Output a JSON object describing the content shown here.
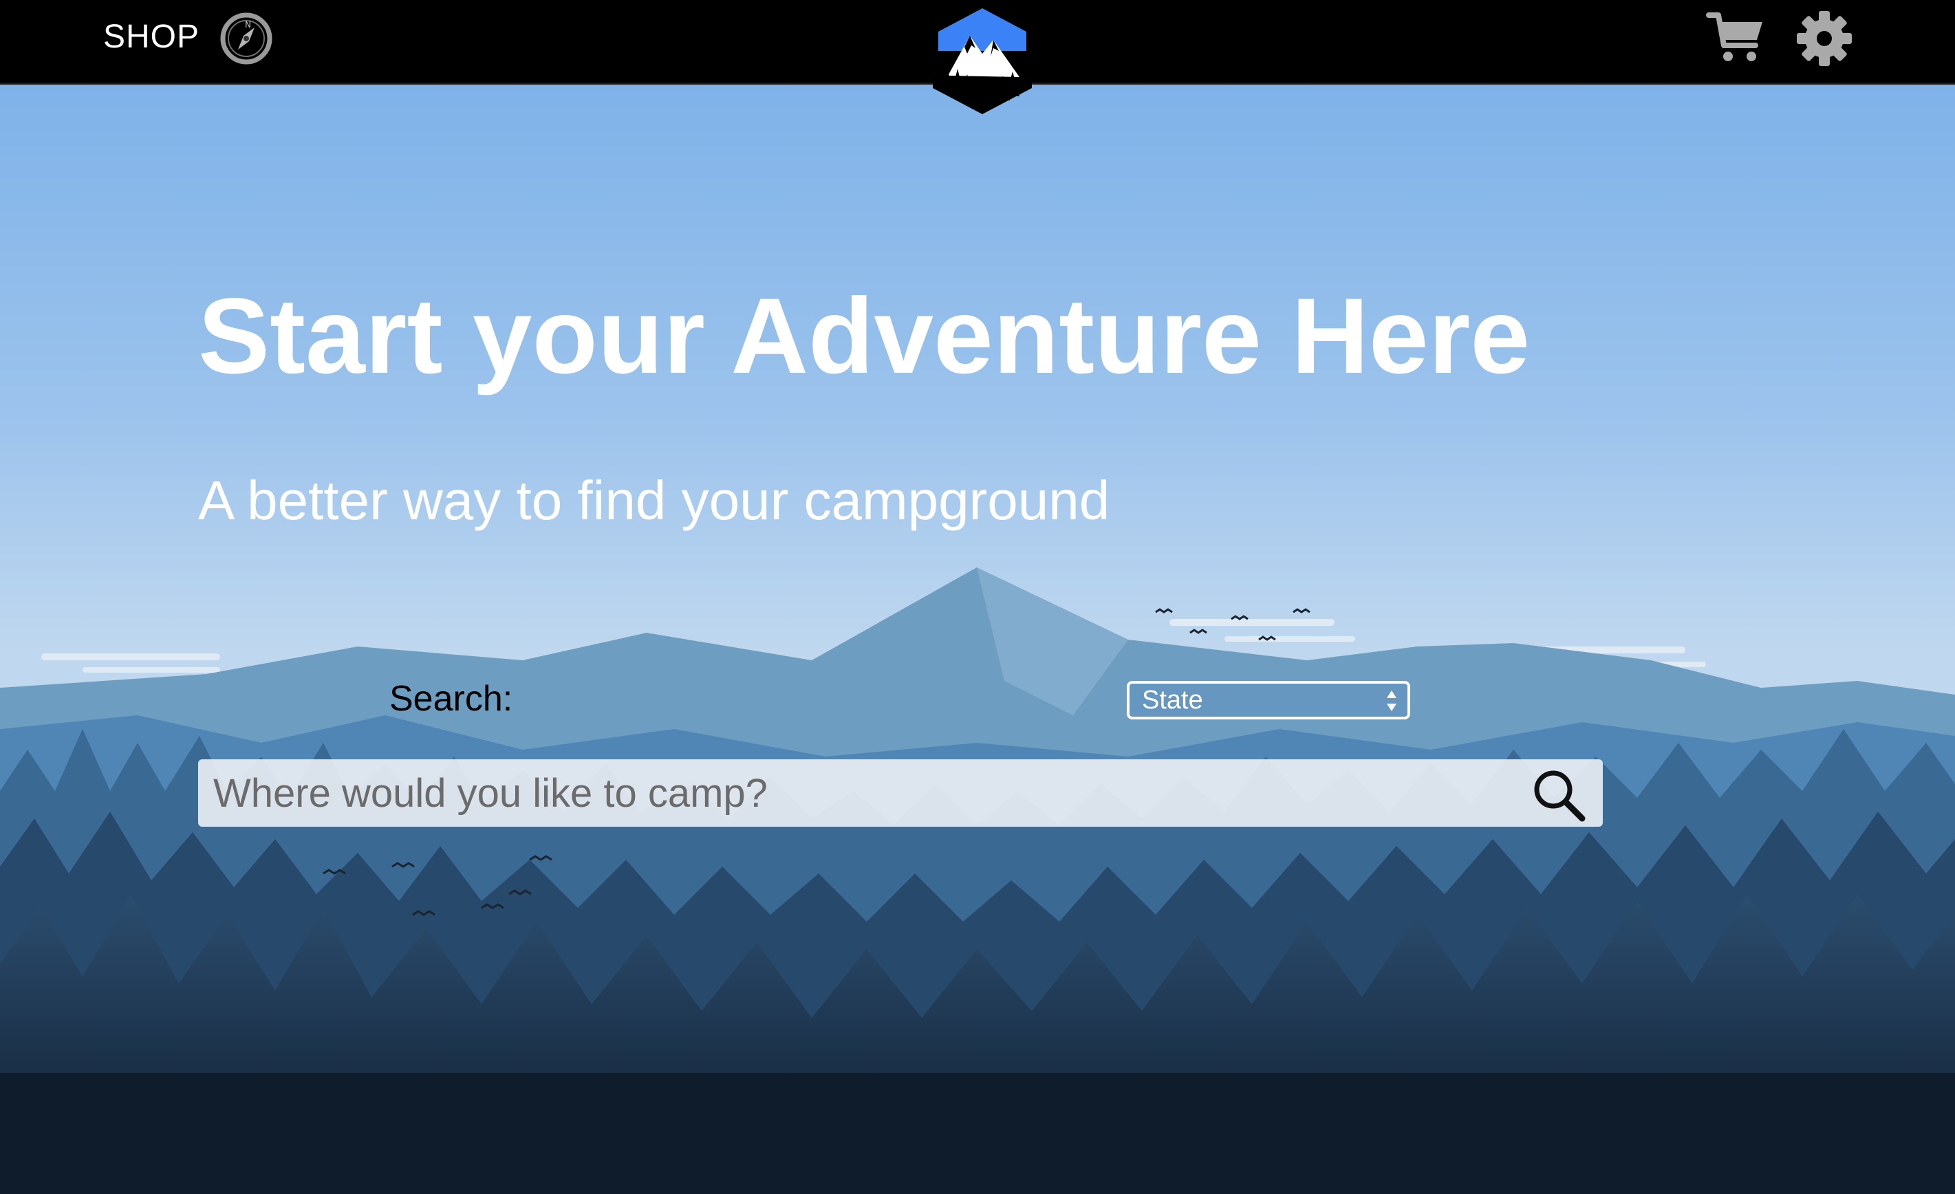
{
  "nav": {
    "shop_label": "SHOP",
    "left_icon": "compass-icon",
    "logo_icon": "mountain-logo-icon",
    "right_icons": [
      "cart-icon",
      "gear-icon"
    ]
  },
  "hero": {
    "title": "Start your Adventure Here",
    "subtitle": "A better way to find your campground"
  },
  "search": {
    "label": "Search:",
    "state_select_value": "State",
    "placeholder": "Where would you like to camp?",
    "button_icon": "search-icon"
  },
  "colors": {
    "topbar": "#000000",
    "sky_top": "#7aaee6",
    "sky_bottom": "#bcd6ef",
    "text": "#ffffff",
    "logo_blue": "#3b82f6"
  }
}
